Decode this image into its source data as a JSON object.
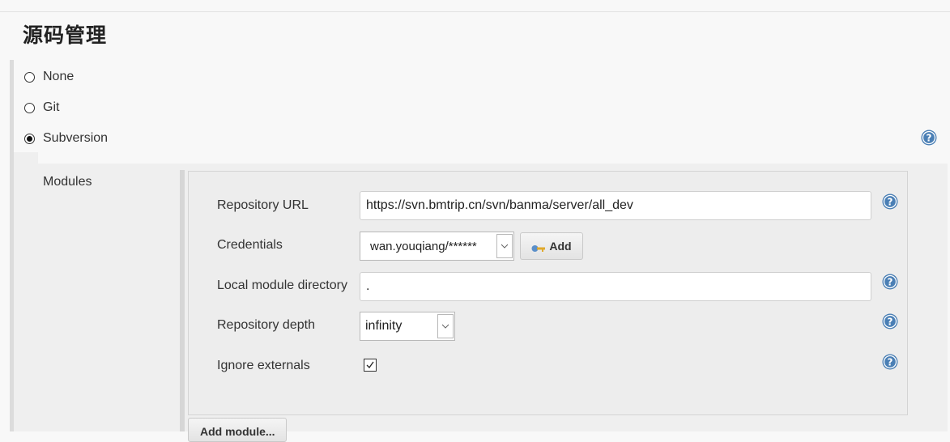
{
  "section": {
    "title": "源码管理"
  },
  "scm_options": [
    {
      "label": "None",
      "checked": false
    },
    {
      "label": "Git",
      "checked": false
    },
    {
      "label": "Subversion",
      "checked": true
    }
  ],
  "modules": {
    "label": "Modules",
    "repository_url": {
      "label": "Repository URL",
      "value": "https://svn.bmtrip.cn/svn/banma/server/all_dev"
    },
    "credentials": {
      "label": "Credentials",
      "selected": "wan.youqiang/******",
      "add_label": "Add"
    },
    "local_module_directory": {
      "label": "Local module directory",
      "value": "."
    },
    "repository_depth": {
      "label": "Repository depth",
      "selected": "infinity"
    },
    "ignore_externals": {
      "label": "Ignore externals",
      "checked": true
    },
    "add_module_label": "Add module..."
  },
  "icons": {
    "help": "help-icon",
    "key": "key-icon",
    "dropdown": "chevron-down-icon",
    "checkmark": "checkmark-icon"
  },
  "colors": {
    "help_icon": "#4a7fb5",
    "page_bg": "#f8f8f8",
    "panel_bg": "#efefef"
  }
}
